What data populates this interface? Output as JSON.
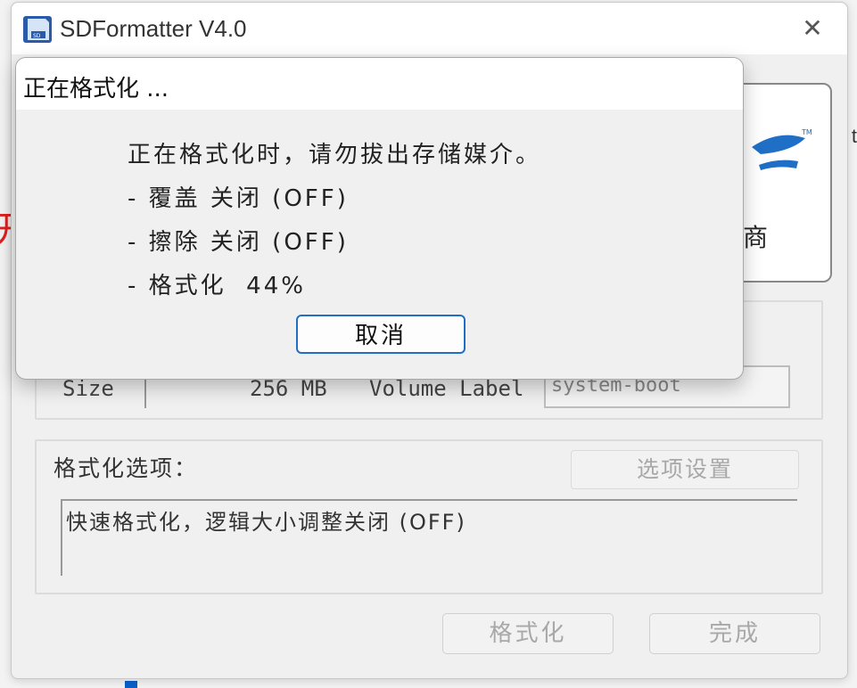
{
  "window": {
    "title": "SDFormatter V4.0",
    "close_glyph": "✕"
  },
  "logo": {
    "partial_text": "商"
  },
  "disk": {
    "size_label": "Size",
    "size_value": "256 MB",
    "volume_label": "Volume Label",
    "volume_value": "system-boot"
  },
  "options": {
    "title": "格式化选项：",
    "settings_button": "选项设置",
    "summary": "快速格式化，逻辑大小调整关闭 (OFF)"
  },
  "footer": {
    "format_button": "格式化",
    "done_button": "完成"
  },
  "dialog": {
    "title": "正在格式化 ...",
    "lines": [
      "正在格式化时，请勿拔出存储媒介。",
      "- 覆盖 关闭 (OFF)",
      "- 擦除 关闭 (OFF)",
      "- 格式化  44%"
    ],
    "progress_percent": 44,
    "cancel_button": "取消"
  },
  "background": {
    "red_glyph": "开",
    "right_glyph": "t"
  },
  "colors": {
    "accent": "#1f6fc7",
    "red": "#e02020"
  }
}
